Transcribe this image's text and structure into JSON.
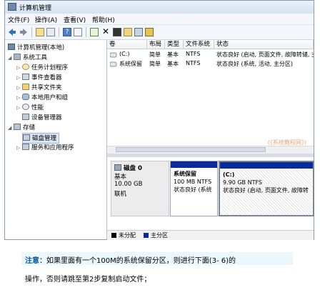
{
  "window": {
    "title": "计算机管理",
    "menu": [
      "文件(F)",
      "操作(A)",
      "查看(V)",
      "帮助(H)"
    ]
  },
  "tree": {
    "root": "计算机管理(本地)",
    "system_tools": "系统工具",
    "items": [
      "任务计划程序",
      "事件查看器",
      "共享文件夹",
      "本地用户和组",
      "性能",
      "设备管理器"
    ],
    "storage": "存储",
    "disk_management": "磁盘管理",
    "services": "服务和应用程序"
  },
  "volume_table": {
    "headers": [
      "卷",
      "布局",
      "类型",
      "文件系统",
      "状态"
    ],
    "rows": [
      [
        "(C:)",
        "简单",
        "基本",
        "NTFS",
        "状态良好 (启动, 页面文件, 故障转储, 主"
      ],
      [
        "系统保留",
        "简单",
        "基本",
        "NTFS",
        "状态良好 (系统, 活动, 主分区)"
      ]
    ]
  },
  "watermark": "(《系统教程网》)",
  "disk": {
    "name": "磁盘 0",
    "type": "基本",
    "size": "10.00 GB",
    "status": "联机",
    "partitions": [
      {
        "name": "系统保留",
        "size": "100 MB NTFS",
        "status": "状态良好 (系统"
      },
      {
        "name": "(C:)",
        "size": "9.90 GB NTFS",
        "status": "状态良好 (启动, 页面文件, 故障转"
      }
    ]
  },
  "legend": [
    "未分配",
    "主分区"
  ],
  "colors": {
    "unallocated": "#000000",
    "primary": "#0a2c9b"
  },
  "note": {
    "label": "注意",
    "line1_rest": "：如果里面有一个100M的系统保留分区，则进行下面(3- 6)的",
    "line2": "操作，否则请跳至第2步复制启动文件；"
  }
}
